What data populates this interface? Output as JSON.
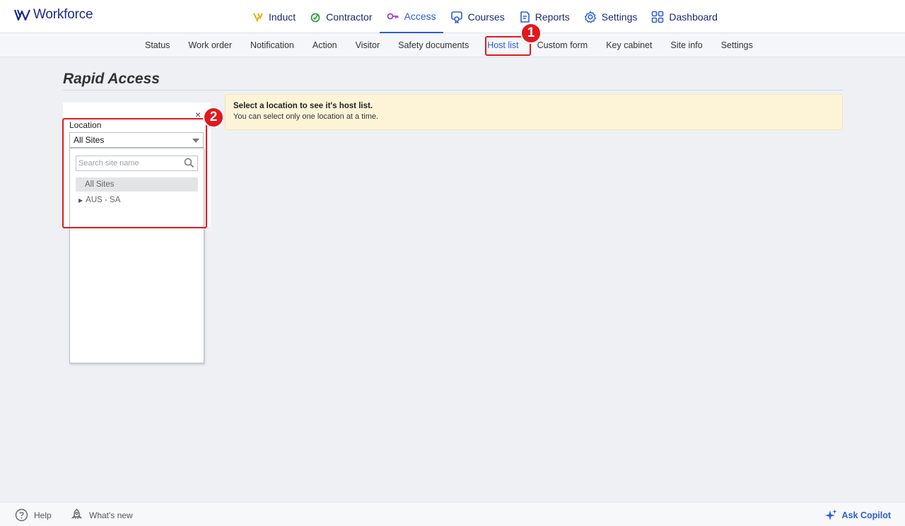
{
  "brand": {
    "name": "Workforce"
  },
  "main_nav": [
    {
      "label": "Induct",
      "icon": "induct-icon",
      "active": false
    },
    {
      "label": "Contractor",
      "icon": "contractor-icon",
      "active": false
    },
    {
      "label": "Access",
      "icon": "key-icon",
      "active": true
    },
    {
      "label": "Courses",
      "icon": "courses-icon",
      "active": false
    },
    {
      "label": "Reports",
      "icon": "reports-icon",
      "active": false
    },
    {
      "label": "Settings",
      "icon": "gear-icon",
      "active": false
    },
    {
      "label": "Dashboard",
      "icon": "dashboard-icon",
      "active": false
    }
  ],
  "sub_nav": [
    {
      "label": "Status"
    },
    {
      "label": "Work order"
    },
    {
      "label": "Notification"
    },
    {
      "label": "Action"
    },
    {
      "label": "Visitor"
    },
    {
      "label": "Safety documents"
    },
    {
      "label": "Host list",
      "active": true
    },
    {
      "label": "Custom form"
    },
    {
      "label": "Key cabinet"
    },
    {
      "label": "Site info"
    },
    {
      "label": "Settings"
    }
  ],
  "annotations": {
    "badge1": "1",
    "badge2": "2"
  },
  "page": {
    "title": "Rapid Access"
  },
  "location_panel": {
    "close_glyph": "×",
    "label": "Location",
    "selected": "All Sites",
    "search_placeholder": "Search site name",
    "options": [
      {
        "label": "All Sites",
        "selected": true,
        "expandable": false
      },
      {
        "label": "AUS - SA",
        "selected": false,
        "expandable": true
      }
    ]
  },
  "info_banner": {
    "title": "Select a location to see it's host list.",
    "body": "You can select only one location at a time."
  },
  "footer": {
    "help": "Help",
    "whats_new": "What's new",
    "copilot": "Ask Copilot"
  },
  "colors": {
    "accent": "#2b5cd6",
    "brand": "#1b2a8a",
    "highlight": "#e0191f",
    "banner": "#fdf4d8"
  }
}
